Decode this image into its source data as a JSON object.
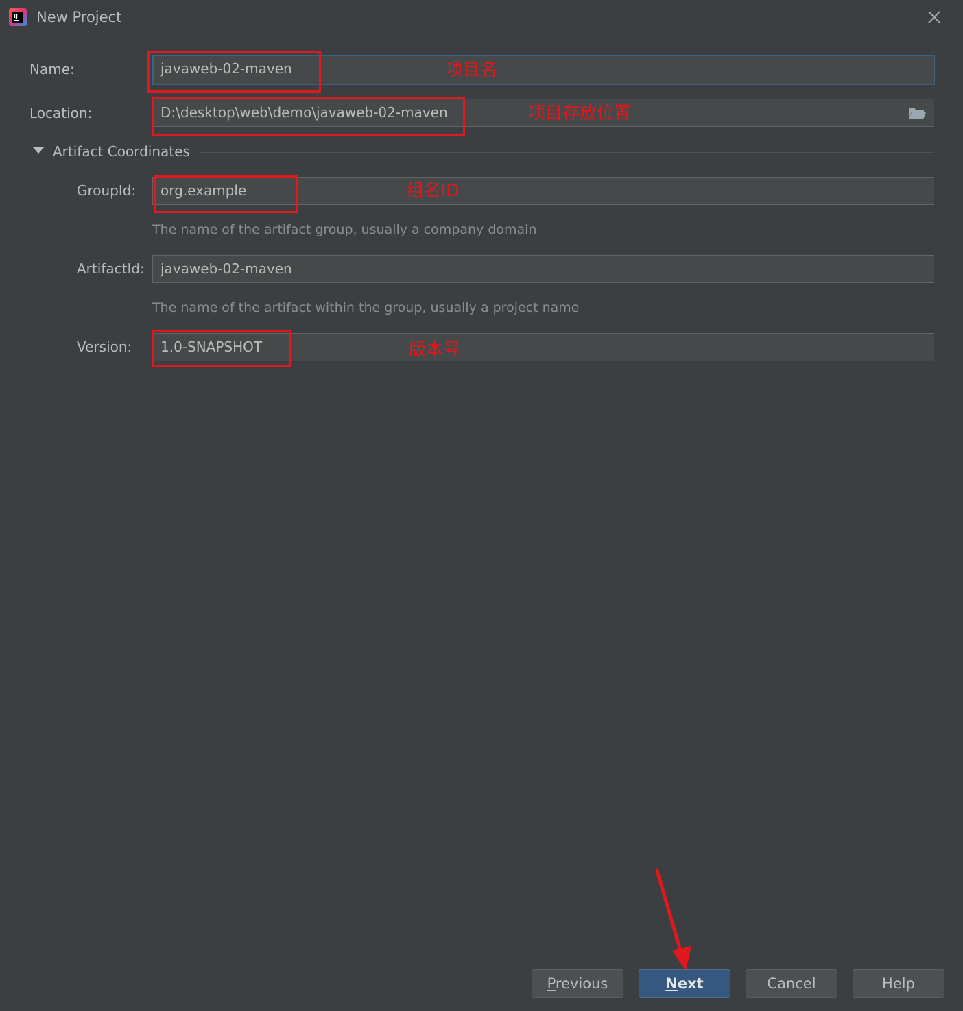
{
  "window": {
    "title": "New Project",
    "app_icon_text": "IJ"
  },
  "form": {
    "name": {
      "label": "Name:",
      "value": "javaweb-02-maven"
    },
    "location": {
      "label": "Location:",
      "value": "D:\\desktop\\web\\demo\\javaweb-02-maven"
    },
    "section": {
      "title": "Artifact Coordinates",
      "expanded": true
    },
    "group_id": {
      "label": "GroupId:",
      "value": "org.example",
      "hint": "The name of the artifact group, usually a company domain"
    },
    "artifact_id": {
      "label": "ArtifactId:",
      "value": "javaweb-02-maven",
      "hint": "The name of the artifact within the group, usually a project name"
    },
    "version": {
      "label": "Version:",
      "value": "1.0-SNAPSHOT"
    }
  },
  "annotations": {
    "name_note": "项目名",
    "location_note": "项目存放位置",
    "group_note": "组名ID",
    "version_note": "版本号",
    "color": "#e0191e"
  },
  "buttons": {
    "previous": {
      "mnemonic": "P",
      "rest": "revious"
    },
    "next": {
      "mnemonic": "N",
      "rest": "ext"
    },
    "cancel": "Cancel",
    "help": "Help"
  },
  "colors": {
    "background": "#3c3f41",
    "field": "#45494a",
    "focus_border": "#3d6185",
    "primary_button": "#365880"
  },
  "icons": [
    "intellij-app-icon",
    "close-icon",
    "folder-icon",
    "expand-triangle-icon"
  ]
}
